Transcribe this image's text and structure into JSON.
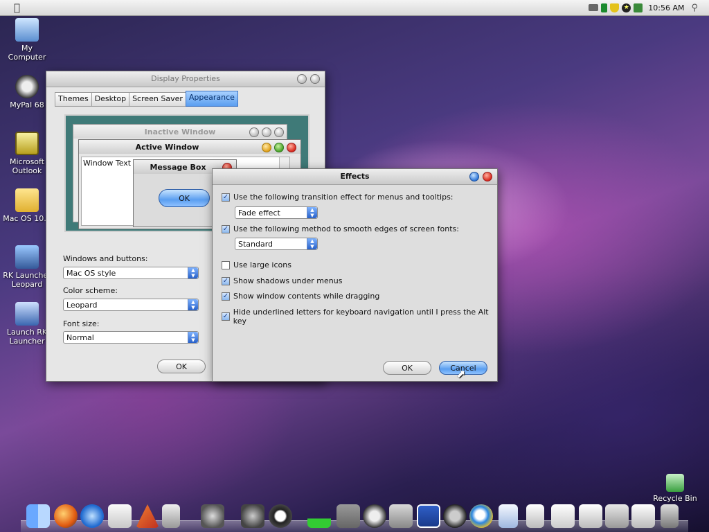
{
  "menubar": {
    "clock": "10:56 AM"
  },
  "desktop_icons": [
    {
      "label": "My Computer"
    },
    {
      "label": "MyPal 68"
    },
    {
      "label": "Microsoft Outlook"
    },
    {
      "label": "Mac OS 10.4"
    },
    {
      "label": "RK Launcher Leopard"
    },
    {
      "label": "Launch RK Launcher"
    },
    {
      "label": "Recycle Bin"
    }
  ],
  "display_properties": {
    "title": "Display Properties",
    "tabs": [
      "Themes",
      "Desktop",
      "Screen Saver",
      "Appearance"
    ],
    "active_tab": "Appearance",
    "preview": {
      "inactive_title": "Inactive Window",
      "active_title": "Active Window",
      "window_text": "Window Text",
      "message_box_title": "Message Box",
      "ok_label": "OK"
    },
    "windows_buttons_label": "Windows and buttons:",
    "windows_buttons_value": "Mac OS style",
    "color_scheme_label": "Color scheme:",
    "color_scheme_value": "Leopard",
    "font_size_label": "Font size:",
    "font_size_value": "Normal",
    "ok_label": "OK"
  },
  "effects": {
    "title": "Effects",
    "transition_label": "Use the following transition effect for menus and tooltips:",
    "transition_value": "Fade effect",
    "smooth_label": "Use the following method to smooth edges of screen fonts:",
    "smooth_value": "Standard",
    "large_icons_label": "Use large icons",
    "shadows_label": "Show shadows under menus",
    "drag_label": "Show window contents while dragging",
    "underline_label": "Hide underlined letters for keyboard navigation until I press the Alt key",
    "ok_label": "OK",
    "cancel_label": "Cancel",
    "checkboxes": {
      "transition": true,
      "smooth": true,
      "large_icons": false,
      "shadows": true,
      "drag": true,
      "underline": true
    }
  },
  "colors": {
    "accent": "#5a9ef0",
    "close": "#d8281c"
  }
}
